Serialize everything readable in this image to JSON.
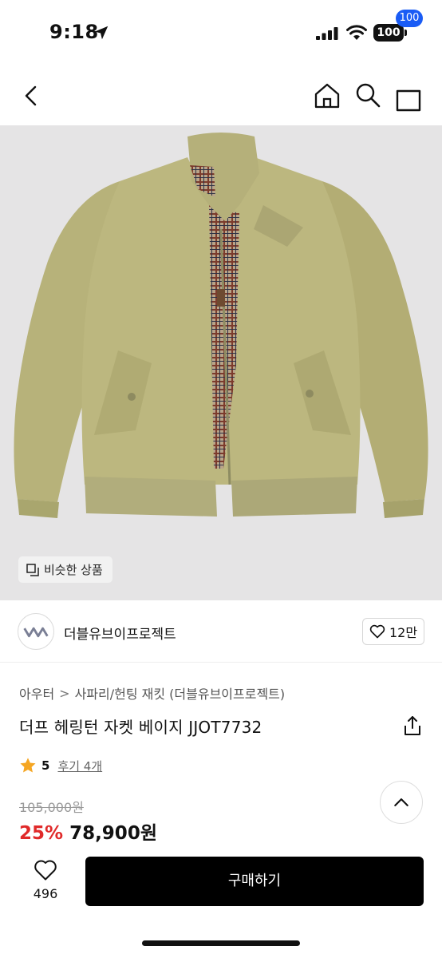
{
  "status_bar": {
    "time": "9:18",
    "battery": "100",
    "icons": [
      "location-arrow-icon",
      "signal-icon",
      "wifi-icon",
      "battery-icon"
    ]
  },
  "nav": {
    "icons": [
      "back-icon",
      "home-icon",
      "search-icon",
      "cart-icon"
    ],
    "cart_count": "100",
    "cart_badge_color": "#1a5cf5"
  },
  "product_image": {
    "similar_button_label": "비슷한 상품"
  },
  "brand": {
    "name": "더블유브이프로젝트",
    "like_count": "12만"
  },
  "breadcrumb": {
    "category": "아우터",
    "separator": ">",
    "subcategory": "사파리/헌팅 재킷 (더블유브이프로젝트)"
  },
  "product": {
    "title": "더프 헤링턴 자켓 베이지 JJOT7732",
    "rating": "5",
    "review_label": "후기 4개",
    "original_price": "105,000원",
    "discount": "25%",
    "sale_price": "78,900원"
  },
  "colors": {
    "discount": "#e02a2a",
    "star": "#f5a623",
    "buy_button": "#000000"
  },
  "bottom_bar": {
    "wish_count": "496",
    "buy_label": "구매하기"
  }
}
